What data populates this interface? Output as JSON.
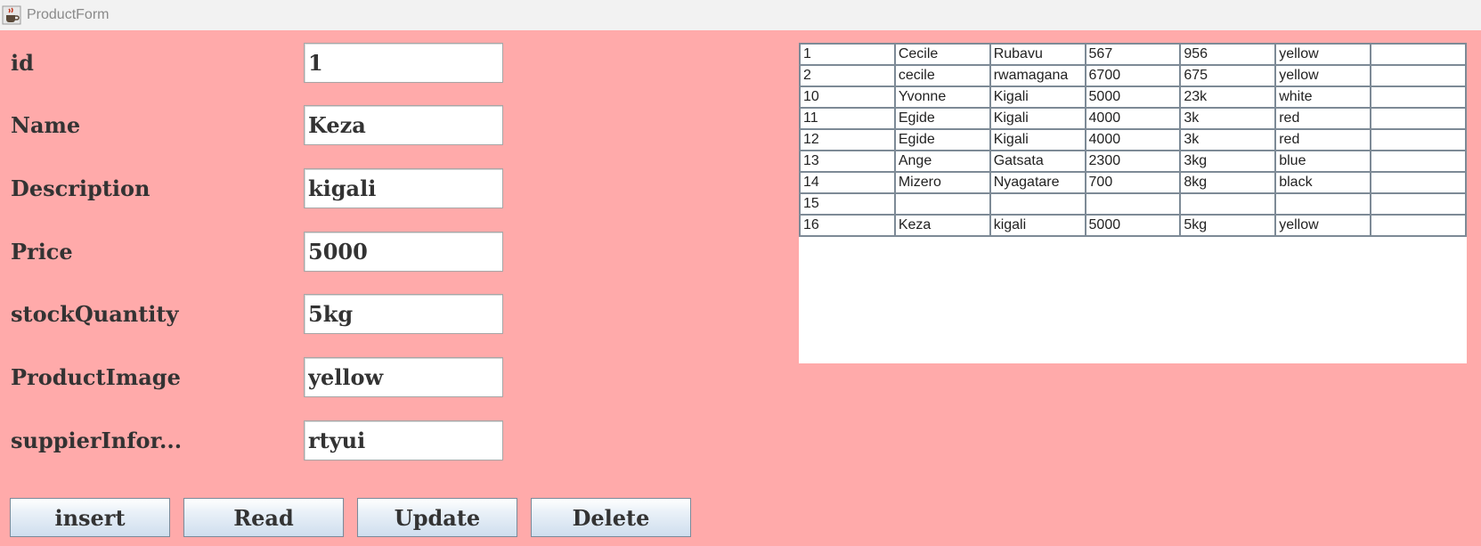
{
  "window": {
    "title": "ProductForm",
    "icon": "java-coffee-cup-icon"
  },
  "form": {
    "fields": [
      {
        "label": "id",
        "value": "1"
      },
      {
        "label": "Name",
        "value": "Keza"
      },
      {
        "label": "Description",
        "value": "kigali"
      },
      {
        "label": "Price",
        "value": "5000"
      },
      {
        "label": "stockQuantity",
        "value": "5kg"
      },
      {
        "label": "ProductImage",
        "value": "yellow"
      },
      {
        "label": "suppierInfor...",
        "value": "rtyui"
      }
    ]
  },
  "buttons": {
    "insert": "insert",
    "read": "Read",
    "update": "Update",
    "delete": "Delete"
  },
  "table": {
    "rows": [
      [
        "1",
        "Cecile",
        "Rubavu",
        "567",
        "956",
        "yellow",
        ""
      ],
      [
        "2",
        "cecile",
        "rwamagana",
        "6700",
        "675",
        "yellow",
        ""
      ],
      [
        "10",
        "Yvonne",
        "Kigali",
        "5000",
        "23k",
        "white",
        ""
      ],
      [
        "11",
        "Egide",
        "Kigali",
        "4000",
        "3k",
        "red",
        ""
      ],
      [
        "12",
        "Egide",
        "Kigali",
        "4000",
        "3k",
        "red",
        ""
      ],
      [
        "13",
        "Ange",
        "Gatsata",
        "2300",
        "3kg",
        "blue",
        ""
      ],
      [
        "14",
        "Mizero",
        "Nyagatare",
        "700",
        "8kg",
        "black",
        ""
      ],
      [
        "15",
        "",
        "",
        "",
        "",
        "",
        ""
      ],
      [
        "16",
        "Keza",
        "kigali",
        "5000",
        "5kg",
        "yellow",
        ""
      ]
    ]
  },
  "colors": {
    "background": "#ffaaaa",
    "titlebar": "#f2f2f2",
    "grid_lines": "#7d8a96"
  }
}
